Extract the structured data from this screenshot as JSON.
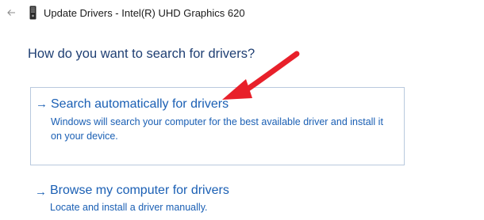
{
  "window": {
    "title": "Update Drivers - Intel(R) UHD Graphics 620",
    "back_icon": "back-arrow-icon",
    "device_icon": "device-manager-icon"
  },
  "heading": "How do you want to search for drivers?",
  "options": [
    {
      "title": "Search automatically for drivers",
      "description": "Windows will search your computer for the best available driver and install it on your device.",
      "arrow_icon": "right-arrow-icon",
      "selected": true
    },
    {
      "title": "Browse my computer for drivers",
      "description": "Locate and install a driver manually.",
      "arrow_icon": "right-arrow-icon",
      "selected": false
    }
  ],
  "colors": {
    "link": "#1a5fb4",
    "heading": "#1f3f73",
    "annotation": "#e8202a",
    "selected_border": "#b9c9de"
  }
}
